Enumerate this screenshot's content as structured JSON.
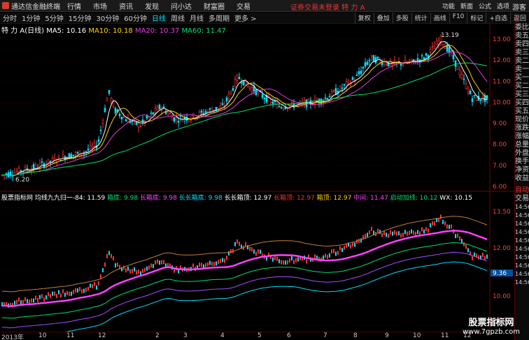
{
  "window": {
    "app_title": "通达信金融终端",
    "login_warning": "证券交易未登录  特 力 A",
    "guest": "游客"
  },
  "menu": [
    "行情",
    "市场",
    "资讯",
    "发现",
    "问小达",
    "财富圈",
    "交易"
  ],
  "right_menu": [
    "功能",
    "新面",
    "公式",
    "选项"
  ],
  "periods": [
    "分时",
    "1分钟",
    "5分钟",
    "15分钟",
    "30分钟",
    "60分钟",
    "日线",
    "周线",
    "月线",
    "多周期",
    "更多 >"
  ],
  "active_period": "日线",
  "tools": [
    "复权",
    "叠加",
    "多股",
    "统计",
    "画线",
    "F10",
    "标记",
    "+自选",
    "返回"
  ],
  "main_header": {
    "symbol": "特 力 A(日线)",
    "ma5": "MA5: 10.16",
    "ma10": "MA10: 10.18",
    "ma20": "MA20: 10.37",
    "ma60": "MA60: 11.47"
  },
  "indicator_header": {
    "name": "股票指标网",
    "formula": "均线九九归一-84: 11.59",
    "box_bottom": "箱底: 9.98",
    "long_box_bottom": "长箱底: 9.98",
    "long_long_box_bottom": "长长箱底: 9.98",
    "long_long_box_top": "长长箱顶: 12.97",
    "long_box_top": "长箱顶: 12.97",
    "box_top": "箱顶: 12.97",
    "mid_axis": "中间: 11.47",
    "start_add": "启动加线: 10.12",
    "wx": "WX: 10.15"
  },
  "price_axis": [
    "13.00",
    "12.00",
    "11.00",
    "10.00",
    "9.00",
    "8.00",
    "7.00",
    "6.00"
  ],
  "price_extremes": {
    "high": "13.19",
    "low": "6.20"
  },
  "indicator_axis": [
    "13.50",
    "12.00",
    "11.00",
    "10.00",
    "9.00"
  ],
  "indicator_marker": "9.36",
  "date_axis": [
    "2013年",
    "10",
    "11",
    "12",
    "2",
    "3",
    "4",
    "5",
    "6",
    "7",
    "8",
    "9",
    "10",
    "11",
    "12"
  ],
  "sidebar": [
    "委比",
    "卖五",
    "卖四",
    "卖三",
    "卖二",
    "卖一",
    "买一",
    "买二",
    "买三",
    "买四",
    "买五",
    "现价",
    "涨跌",
    "涨幅",
    "总量",
    "外盘",
    "换手",
    "净资",
    "收益"
  ],
  "sidebar_bottom": [
    "自动",
    "交易",
    "14:56",
    "14:56",
    "14:56",
    "14:56",
    "14:56",
    "14:56",
    "14:56",
    "14:56",
    "14:56",
    "14:56"
  ],
  "watermark": {
    "title": "股票指标网",
    "url": "www.7gpzb.com"
  },
  "colors": {
    "bg": "#000000",
    "up": "#ff3030",
    "down": "#00e0ff",
    "ma5": "#ffffff",
    "ma10": "#ffd200",
    "ma20": "#e040e0",
    "ma60": "#00e070"
  },
  "lp_badge": "L\nR"
}
